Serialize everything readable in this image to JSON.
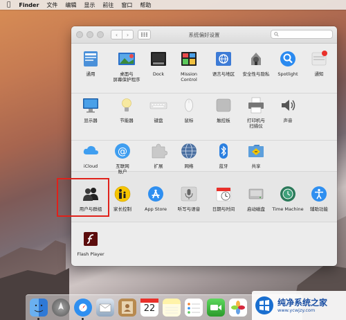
{
  "menubar": {
    "items": [
      "Finder",
      "文件",
      "编辑",
      "显示",
      "前往",
      "窗口",
      "帮助"
    ]
  },
  "window": {
    "title": "系统偏好设置",
    "search_placeholder": ""
  },
  "prefs": {
    "row1": [
      {
        "label": "通用",
        "icon": "general-icon"
      },
      {
        "label": "桌面与\n屏幕保护程序",
        "icon": "desktop-screensaver-icon"
      },
      {
        "label": "Dock",
        "icon": "dock-icon"
      },
      {
        "label": "Mission\nControl",
        "icon": "mission-control-icon"
      },
      {
        "label": "语言与地区",
        "icon": "language-region-icon"
      },
      {
        "label": "安全性与隐私",
        "icon": "security-privacy-icon"
      },
      {
        "label": "Spotlight",
        "icon": "spotlight-icon"
      },
      {
        "label": "通知",
        "icon": "notifications-icon"
      }
    ],
    "row2": [
      {
        "label": "显示器",
        "icon": "displays-icon"
      },
      {
        "label": "节能器",
        "icon": "energy-saver-icon"
      },
      {
        "label": "键盘",
        "icon": "keyboard-icon"
      },
      {
        "label": "鼠标",
        "icon": "mouse-icon"
      },
      {
        "label": "触控板",
        "icon": "trackpad-icon"
      },
      {
        "label": "打印机与\n扫描仪",
        "icon": "printers-scanners-icon"
      },
      {
        "label": "声音",
        "icon": "sound-icon"
      }
    ],
    "row3": [
      {
        "label": "iCloud",
        "icon": "icloud-icon"
      },
      {
        "label": "互联网\n账户",
        "icon": "internet-accounts-icon"
      },
      {
        "label": "扩展",
        "icon": "extensions-icon"
      },
      {
        "label": "网络",
        "icon": "network-icon"
      },
      {
        "label": "蓝牙",
        "icon": "bluetooth-icon"
      },
      {
        "label": "共享",
        "icon": "sharing-icon"
      }
    ],
    "row4": [
      {
        "label": "用户与群组",
        "icon": "users-groups-icon"
      },
      {
        "label": "家长控制",
        "icon": "parental-controls-icon"
      },
      {
        "label": "App Store",
        "icon": "app-store-icon"
      },
      {
        "label": "听写与语音",
        "icon": "dictation-speech-icon"
      },
      {
        "label": "日期与时间",
        "icon": "date-time-icon"
      },
      {
        "label": "启动磁盘",
        "icon": "startup-disk-icon"
      },
      {
        "label": "Time Machine",
        "icon": "time-machine-icon"
      },
      {
        "label": "辅助功能",
        "icon": "accessibility-icon"
      }
    ],
    "row5": [
      {
        "label": "Flash Player",
        "icon": "flash-player-icon"
      }
    ]
  },
  "dock": {
    "calendar_day": "22"
  },
  "watermark": {
    "title": "纯净系统之家",
    "url": "www.ycwjzy.com"
  },
  "colors": {
    "highlight": "#e0211a",
    "accent_blue": "#1a8af0"
  }
}
